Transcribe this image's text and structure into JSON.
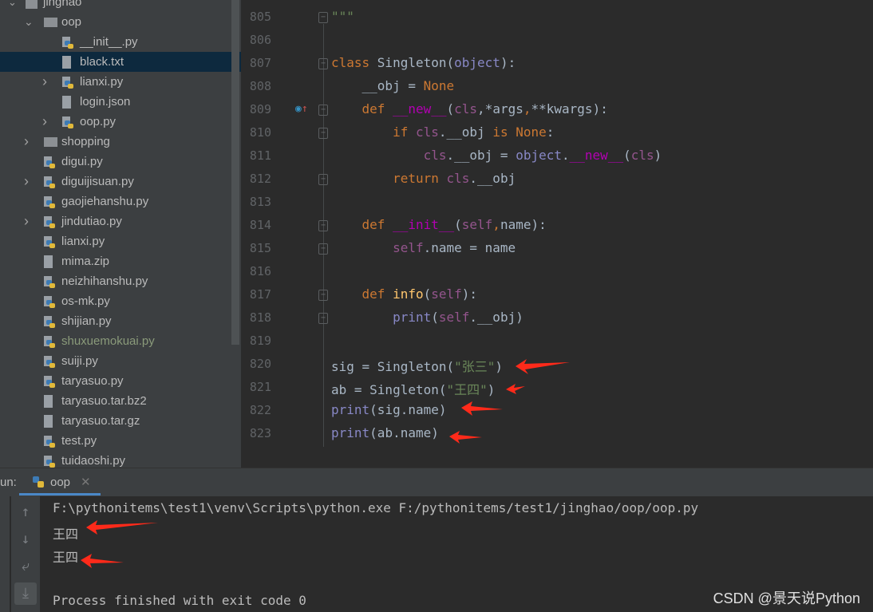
{
  "project_tree": {
    "root": "jinghao",
    "items": [
      {
        "name": "oop",
        "type": "package",
        "level": 1,
        "expanded": true
      },
      {
        "name": "__init__.py",
        "type": "python",
        "level": 2
      },
      {
        "name": "black.txt",
        "type": "text",
        "level": 2,
        "selected": true
      },
      {
        "name": "lianxi.py",
        "type": "python",
        "level": 2,
        "collapsible": true
      },
      {
        "name": "login.json",
        "type": "json",
        "level": 2
      },
      {
        "name": "oop.py",
        "type": "python",
        "level": 2,
        "collapsible": true
      },
      {
        "name": "shopping",
        "type": "folder",
        "level": 1,
        "collapsible": true
      },
      {
        "name": "digui.py",
        "type": "python",
        "level": 1
      },
      {
        "name": "diguijisuan.py",
        "type": "python",
        "level": 1,
        "collapsible": true
      },
      {
        "name": "gaojiehanshu.py",
        "type": "python",
        "level": 1
      },
      {
        "name": "jindutiao.py",
        "type": "python",
        "level": 1,
        "collapsible": true
      },
      {
        "name": "lianxi.py",
        "type": "python",
        "level": 1
      },
      {
        "name": "mima.zip",
        "type": "zip",
        "level": 1
      },
      {
        "name": "neizhihanshu.py",
        "type": "python",
        "level": 1
      },
      {
        "name": "os-mk.py",
        "type": "python",
        "level": 1
      },
      {
        "name": "shijian.py",
        "type": "python",
        "level": 1
      },
      {
        "name": "shuxuemokuai.py",
        "type": "python",
        "level": 1,
        "dim": true
      },
      {
        "name": "suiji.py",
        "type": "python",
        "level": 1
      },
      {
        "name": "taryasuo.py",
        "type": "python",
        "level": 1
      },
      {
        "name": "taryasuo.tar.bz2",
        "type": "unknown",
        "level": 1
      },
      {
        "name": "taryasuo.tar.gz",
        "type": "unknown",
        "level": 1
      },
      {
        "name": "test.py",
        "type": "python",
        "level": 1
      },
      {
        "name": "tuidaoshi.py",
        "type": "python",
        "level": 1
      }
    ]
  },
  "editor": {
    "lines": [
      {
        "n": "805",
        "tokens": [
          [
            "\"\"\"",
            "st"
          ]
        ],
        "fold": true
      },
      {
        "n": "806",
        "tokens": []
      },
      {
        "n": "807",
        "tokens": [
          [
            "class ",
            "kw"
          ],
          [
            "Singleton",
            ""
          ],
          [
            "(",
            ""
          ],
          [
            "object",
            "bi"
          ],
          [
            "):",
            ""
          ]
        ],
        "fold": true
      },
      {
        "n": "808",
        "tokens": [
          [
            "    __obj = ",
            ""
          ],
          [
            "None",
            "kw"
          ]
        ]
      },
      {
        "n": "809",
        "tokens": [
          [
            "    ",
            ""
          ],
          [
            "def ",
            "kw"
          ],
          [
            "__new__",
            "mg"
          ],
          [
            "(",
            ""
          ],
          [
            "cls",
            "sf"
          ],
          [
            ",",
            ""
          ],
          [
            "*args",
            ""
          ],
          [
            ",",
            "kw"
          ],
          [
            "**kwargs",
            ""
          ],
          [
            "):",
            ""
          ]
        ],
        "fold": true,
        "gutter_icon": "override-icon"
      },
      {
        "n": "810",
        "tokens": [
          [
            "        ",
            ""
          ],
          [
            "if ",
            "kw"
          ],
          [
            "cls",
            "sf"
          ],
          [
            ".__obj ",
            ""
          ],
          [
            "is None",
            "kw"
          ],
          [
            ":",
            ""
          ]
        ],
        "fold": true
      },
      {
        "n": "811",
        "tokens": [
          [
            "            ",
            ""
          ],
          [
            "cls",
            "sf"
          ],
          [
            ".__obj = ",
            ""
          ],
          [
            "object",
            "bi"
          ],
          [
            ".",
            ""
          ],
          [
            "__new__",
            "mg"
          ],
          [
            "(",
            ""
          ],
          [
            "cls",
            "sf"
          ],
          [
            ")",
            ""
          ]
        ]
      },
      {
        "n": "812",
        "tokens": [
          [
            "        ",
            ""
          ],
          [
            "return ",
            "kw"
          ],
          [
            "cls",
            "sf"
          ],
          [
            ".__obj",
            ""
          ]
        ],
        "fold": true
      },
      {
        "n": "813",
        "tokens": []
      },
      {
        "n": "814",
        "tokens": [
          [
            "    ",
            ""
          ],
          [
            "def ",
            "kw"
          ],
          [
            "__init__",
            "mg"
          ],
          [
            "(",
            ""
          ],
          [
            "self",
            "sf"
          ],
          [
            ",",
            "kw"
          ],
          [
            "name):",
            ""
          ]
        ],
        "fold": true
      },
      {
        "n": "815",
        "tokens": [
          [
            "        ",
            ""
          ],
          [
            "self",
            "sf"
          ],
          [
            ".name = name",
            ""
          ]
        ],
        "fold": true
      },
      {
        "n": "816",
        "tokens": []
      },
      {
        "n": "817",
        "tokens": [
          [
            "    ",
            ""
          ],
          [
            "def ",
            "kw"
          ],
          [
            "info",
            "fn"
          ],
          [
            "(",
            ""
          ],
          [
            "self",
            "sf"
          ],
          [
            "):",
            ""
          ]
        ],
        "fold": true
      },
      {
        "n": "818",
        "tokens": [
          [
            "        ",
            ""
          ],
          [
            "print",
            "bi"
          ],
          [
            "(",
            ""
          ],
          [
            "self",
            "sf"
          ],
          [
            ".__obj)",
            ""
          ]
        ],
        "fold": true
      },
      {
        "n": "819",
        "tokens": []
      },
      {
        "n": "820",
        "tokens": [
          [
            "sig = Singleton(",
            ""
          ],
          [
            "\"张三\"",
            "st"
          ],
          [
            ")",
            ""
          ]
        ]
      },
      {
        "n": "821",
        "tokens": [
          [
            "ab = Singleton(",
            ""
          ],
          [
            "\"王四\"",
            "st"
          ],
          [
            ")",
            ""
          ]
        ]
      },
      {
        "n": "822",
        "tokens": [
          [
            "print",
            "bi"
          ],
          [
            "(sig.name)",
            ""
          ]
        ]
      },
      {
        "n": "823",
        "tokens": [
          [
            "print",
            "bi"
          ],
          [
            "(ab.name)",
            ""
          ]
        ]
      }
    ]
  },
  "run": {
    "label": "un:",
    "tab": "oop",
    "output": [
      "F:\\pythonitems\\test1\\venv\\Scripts\\python.exe F:/pythonitems/test1/jinghao/oop/oop.py",
      "王四",
      "王四",
      "",
      "Process finished with exit code 0"
    ]
  },
  "watermark": "CSDN @景天说Python",
  "colors": {
    "keyword": "#cc7832",
    "self": "#94558d",
    "string": "#6a8759",
    "builtin": "#8888c6",
    "magic": "#b200b2",
    "function": "#ffc66d",
    "arrow": "#ff2a1a"
  }
}
